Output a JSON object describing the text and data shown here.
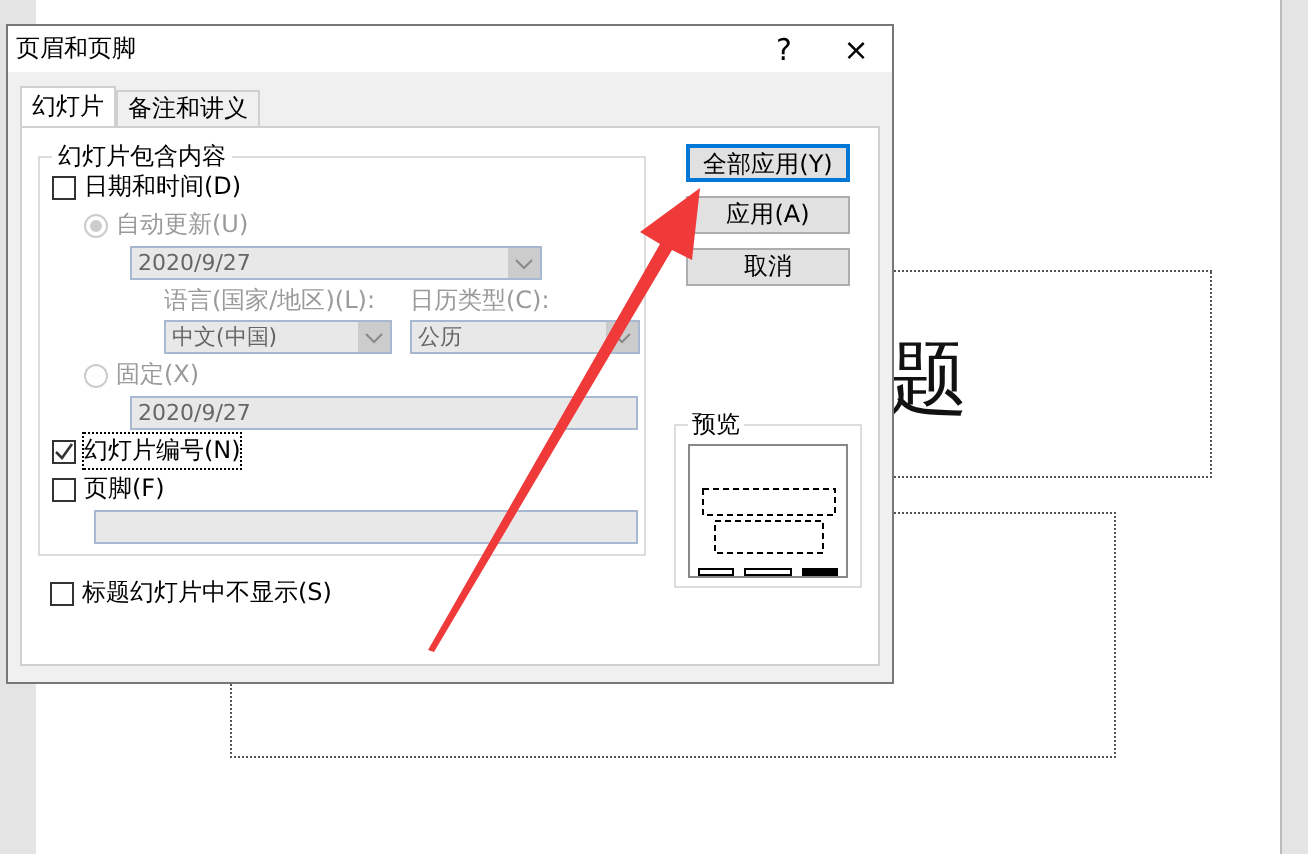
{
  "window": {
    "title": "页眉和页脚",
    "help": "?",
    "close": "×"
  },
  "tabs": [
    {
      "label": "幻灯片",
      "selected": true
    },
    {
      "label": "备注和讲义",
      "selected": false
    }
  ],
  "group": {
    "title": "幻灯片包含内容"
  },
  "date_time": {
    "label": "日期和时间(D)",
    "checked": false
  },
  "auto_update": {
    "label": "自动更新(U)",
    "selected": true,
    "date": "2020/9/27",
    "language_label": "语言(国家/地区)(L):",
    "language": "中文(中国)",
    "calendar_label": "日历类型(C):",
    "calendar": "公历"
  },
  "fixed": {
    "label": "固定(X)",
    "selected": false,
    "date": "2020/9/27"
  },
  "slide_number": {
    "label": "幻灯片编号(N)",
    "checked": true
  },
  "footer": {
    "label": "页脚(F)",
    "checked": false
  },
  "hide_on_title": {
    "label": "标题幻灯片中不显示(S)",
    "checked": false
  },
  "buttons": [
    {
      "label": "全部应用(Y)",
      "default": true
    },
    {
      "label": "应用(A)",
      "default": false
    },
    {
      "label": "取消",
      "default": false
    }
  ],
  "preview": {
    "title": "预览"
  },
  "slide": {
    "title_text": "题"
  }
}
